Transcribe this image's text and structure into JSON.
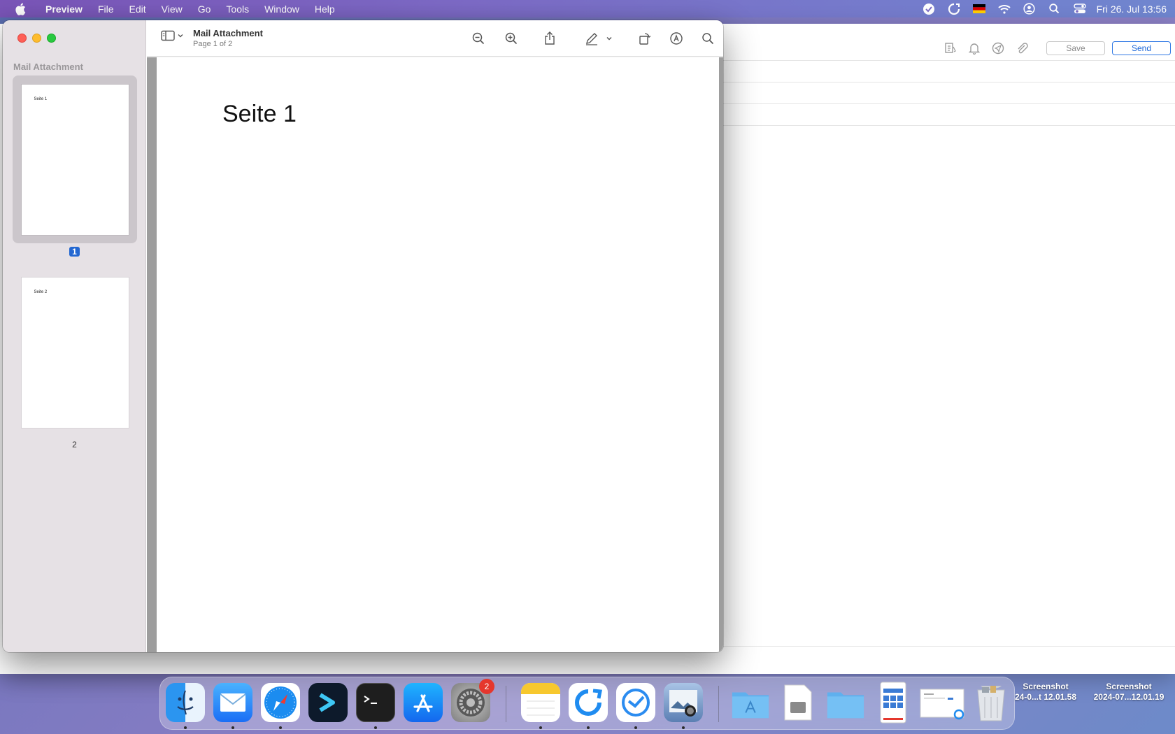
{
  "menubar": {
    "app_name": "Preview",
    "items": [
      "File",
      "Edit",
      "View",
      "Go",
      "Tools",
      "Window",
      "Help"
    ],
    "clock": "Fri 26. Jul  13:56"
  },
  "mail": {
    "save_label": "Save",
    "send_label": "Send"
  },
  "preview": {
    "sidebar_title": "Mail Attachment",
    "doc_title": "Mail Attachment",
    "doc_subtitle": "Page 1 of 2",
    "pages": [
      {
        "thumb_text": "Seite 1",
        "number": "1"
      },
      {
        "thumb_text": "Seite 2",
        "number": "2"
      }
    ],
    "page_heading": "Seite 1"
  },
  "dock": {
    "settings_badge": "2"
  },
  "desktop": {
    "files": [
      {
        "line1": "Screenshot",
        "line2": "24-0...t 12.01.58"
      },
      {
        "line1": "Screenshot",
        "line2": "2024-07...12.01.19"
      }
    ]
  }
}
